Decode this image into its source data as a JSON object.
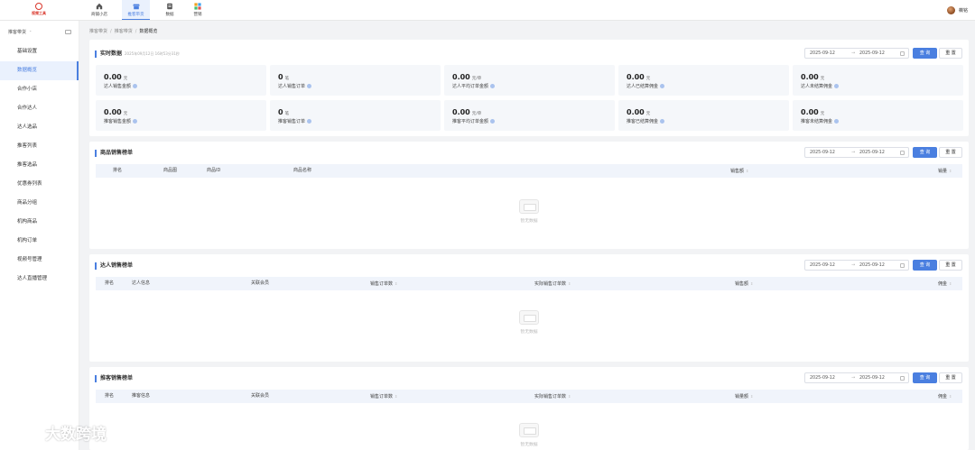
{
  "app": {
    "logo_text": "视频工具"
  },
  "topnav": [
    {
      "label": "商铺小店",
      "icon": "home-icon"
    },
    {
      "label": "推客带货",
      "icon": "store-icon"
    },
    {
      "label": "数据",
      "icon": "data-icon"
    },
    {
      "label": "营销",
      "icon": "grid-icon"
    }
  ],
  "user": {
    "name": "薇铭"
  },
  "sidebar": {
    "header": "推客带货",
    "items": [
      "基础设置",
      "数据概览",
      "合作小店",
      "合作达人",
      "达人选品",
      "推客列表",
      "推客选品",
      "优惠券列表",
      "商品分组",
      "机构商品",
      "机构订单",
      "视频号管理",
      "达人直播管理"
    ]
  },
  "breadcrumb": [
    "推客带货",
    "推客带货",
    "数据概览"
  ],
  "filters": {
    "start": "2025-09-12",
    "arrow": "→",
    "end": "2025-09-12",
    "query": "查 询",
    "reset": "重 置"
  },
  "realtime": {
    "title": "实时数据",
    "updated": "2025年09月12日 16时53分31秒",
    "stats": [
      {
        "value": "0.00",
        "unit": "元",
        "label": "达人销售金额"
      },
      {
        "value": "0",
        "unit": "笔",
        "label": "达人销售订单"
      },
      {
        "value": "0.00",
        "unit": "元/单",
        "label": "达人平均订单金额"
      },
      {
        "value": "0.00",
        "unit": "元",
        "label": "达人已结算佣金"
      },
      {
        "value": "0.00",
        "unit": "元",
        "label": "达人未结算佣金"
      },
      {
        "value": "0.00",
        "unit": "元",
        "label": "推客销售金额"
      },
      {
        "value": "0",
        "unit": "笔",
        "label": "推客销售订单"
      },
      {
        "value": "0.00",
        "unit": "元/单",
        "label": "推客平均订单金额"
      },
      {
        "value": "0.00",
        "unit": "元",
        "label": "推客已结算佣金"
      },
      {
        "value": "0.00",
        "unit": "元",
        "label": "推客未结算佣金"
      }
    ]
  },
  "product_rank": {
    "title": "商品销售榜单",
    "columns": [
      "排名",
      "商品图",
      "商品ID",
      "商品名称",
      "销售额",
      "销量"
    ],
    "empty": "暂无数据"
  },
  "talent_rank": {
    "title": "达人销售榜单",
    "columns": [
      "排名",
      "达人信息",
      "关联会员",
      "销售订单数",
      "实际销售订单数",
      "销售额",
      "佣金"
    ],
    "empty": "暂无数据"
  },
  "promoter_rank": {
    "title": "推客销售榜单",
    "columns": [
      "排名",
      "推客信息",
      "关联会员",
      "销售订单数",
      "实际销售订单数",
      "销量额",
      "佣金"
    ],
    "empty": "暂无数据"
  },
  "watermark": {
    "text": "大数跨境"
  },
  "colors": {
    "accent": "#4a7fe0",
    "brand": "#d9362b",
    "background": "#f2f3f5"
  }
}
